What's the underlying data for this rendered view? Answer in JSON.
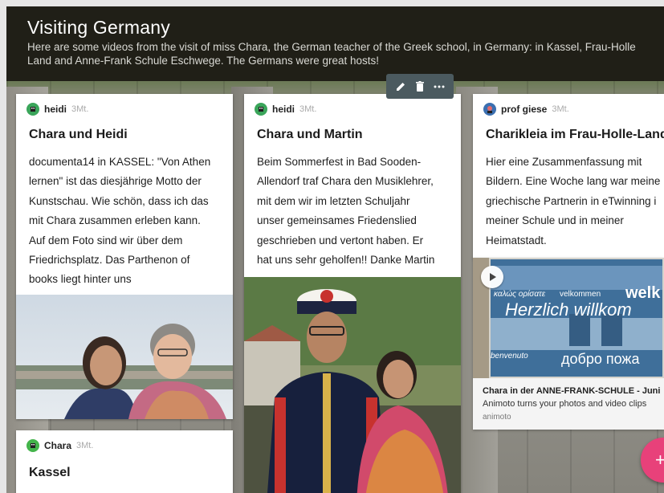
{
  "header": {
    "title": "Visiting Germany",
    "description": "Here are some videos from the visit of miss Chara, the German teacher of the Greek school, in Germany: in Kassel, Frau-Holle Land and Anne-Frank Schule Eschwege. The Germans were great hosts!"
  },
  "toolbar": {
    "edit_icon": "pencil-icon",
    "delete_icon": "trash-icon",
    "more_icon": "more-horizontal-icon"
  },
  "posts": [
    {
      "author": "heidi",
      "age": "3Mt.",
      "title": "Chara und Heidi",
      "body_lines": [
        "documenta14 in KASSEL: \"Von Athen",
        "lernen\" ist das diesjährige Motto der",
        "Kunstschau. Wie schön, dass ich das",
        "mit Chara zusammen erleben kann.",
        "Auf dem Foto sind wir über dem",
        "Friedrichsplatz. Das Parthenon of",
        "books liegt hinter uns"
      ]
    },
    {
      "author": "heidi",
      "age": "3Mt.",
      "title": "Chara und Martin",
      "body_lines": [
        "Beim Sommerfest in Bad Sooden-",
        "Allendorf traf Chara den Musiklehrer,",
        "mit dem wir im letzten Schuljahr",
        "unser gemeinsames Friedenslied",
        "geschrieben und vertont haben. Er",
        "hat uns sehr geholfen!! Danke Martin"
      ]
    },
    {
      "author": "prof giese",
      "age": "3Mt.",
      "title": "Charikleia im Frau-Holle-Land",
      "body_lines": [
        "Hier eine Zusammenfassung mit",
        "Bildern. Eine Woche lang war meine",
        "griechische Partnerin in eTwinning i",
        "meiner Schule und in meiner",
        "Heimatstadt."
      ],
      "link": {
        "sign_text_1": "καλώς ορίσατε",
        "sign_text_2": "velkommen",
        "sign_text_3": "welk",
        "sign_text_4": "Herzlich willkom",
        "sign_text_5": "benvenuto",
        "sign_text_6": "добро пожа",
        "title": "Chara in der ANNE-FRANK-SCHULE - Juni",
        "description": "Animoto turns your photos and video clips",
        "source": "animoto"
      }
    },
    {
      "author": "Chara",
      "age": "3Mt.",
      "title": "Kassel"
    }
  ],
  "fab": {
    "label": "+"
  },
  "colors": {
    "header_bg": "#201f17",
    "fab": "#e8417a",
    "toolbar": "#4b5a5f",
    "avatar_heidi": "#3aa55a",
    "avatar_giese": "#3b6fb0",
    "avatar_chara": "#44b44b"
  }
}
